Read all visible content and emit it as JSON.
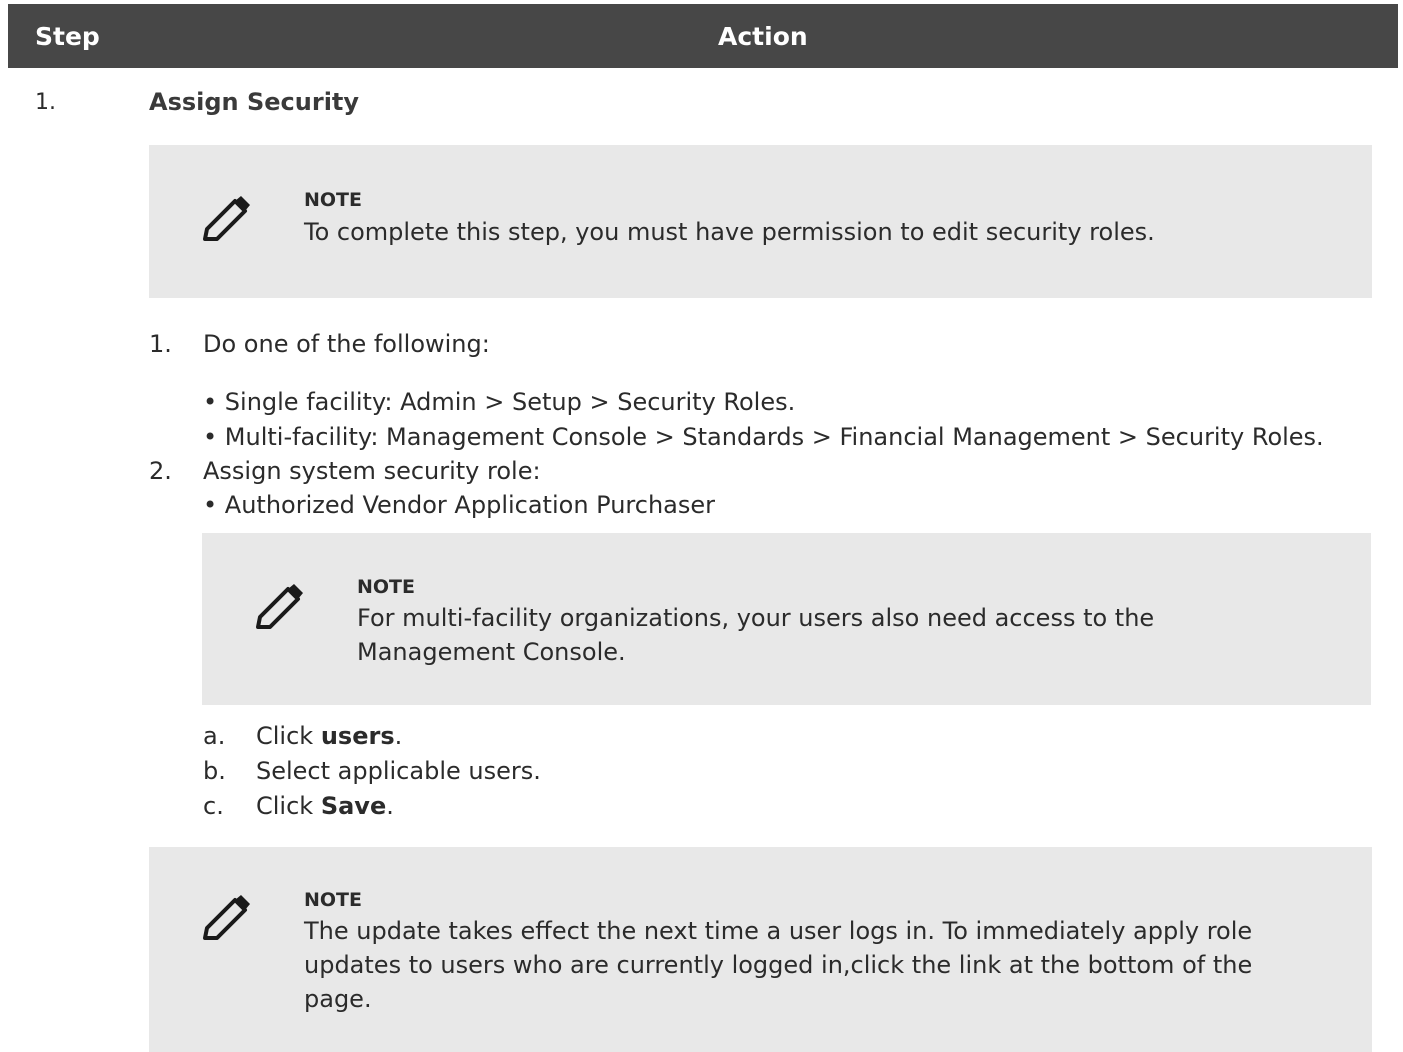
{
  "table_header": {
    "step": "Step",
    "action": "Action"
  },
  "step": {
    "number": "1.",
    "title": "Assign Security"
  },
  "note1": {
    "label": "NOTE",
    "text": "To complete this step, you must have permission to edit security roles."
  },
  "instructions": {
    "item1_num": "1.",
    "item1_text": "Do one of the following:",
    "bullets1": [
      "• Single facility: Admin > Setup > Security Roles.",
      "• Multi-facility: Management Console > Standards > Financial Management > Security Roles."
    ],
    "item2_num": "2.",
    "item2_text": "Assign system security role:",
    "bullets2": [
      "• Authorized Vendor Application Purchaser"
    ]
  },
  "note2": {
    "label": "NOTE",
    "text": "For multi-facility organizations, your users also need access to the Management Console."
  },
  "substeps": {
    "a_letter": "a.",
    "a_pre": "Click ",
    "a_bold": "users",
    "a_post": ".",
    "b_letter": "b.",
    "b_text": "Select applicable users.",
    "c_letter": "c.",
    "c_pre": "Click ",
    "c_bold": "Save",
    "c_post": "."
  },
  "note3": {
    "label": "NOTE",
    "text": "The update takes effect the next time a user logs in. To immediately apply role updates to users who are currently logged in,click the link at the bottom of the page."
  },
  "colors": {
    "header_bg": "#474747",
    "note_bg": "#e8e8e8",
    "text": "#2b2b2b"
  },
  "icons": [
    "pencil-icon"
  ]
}
